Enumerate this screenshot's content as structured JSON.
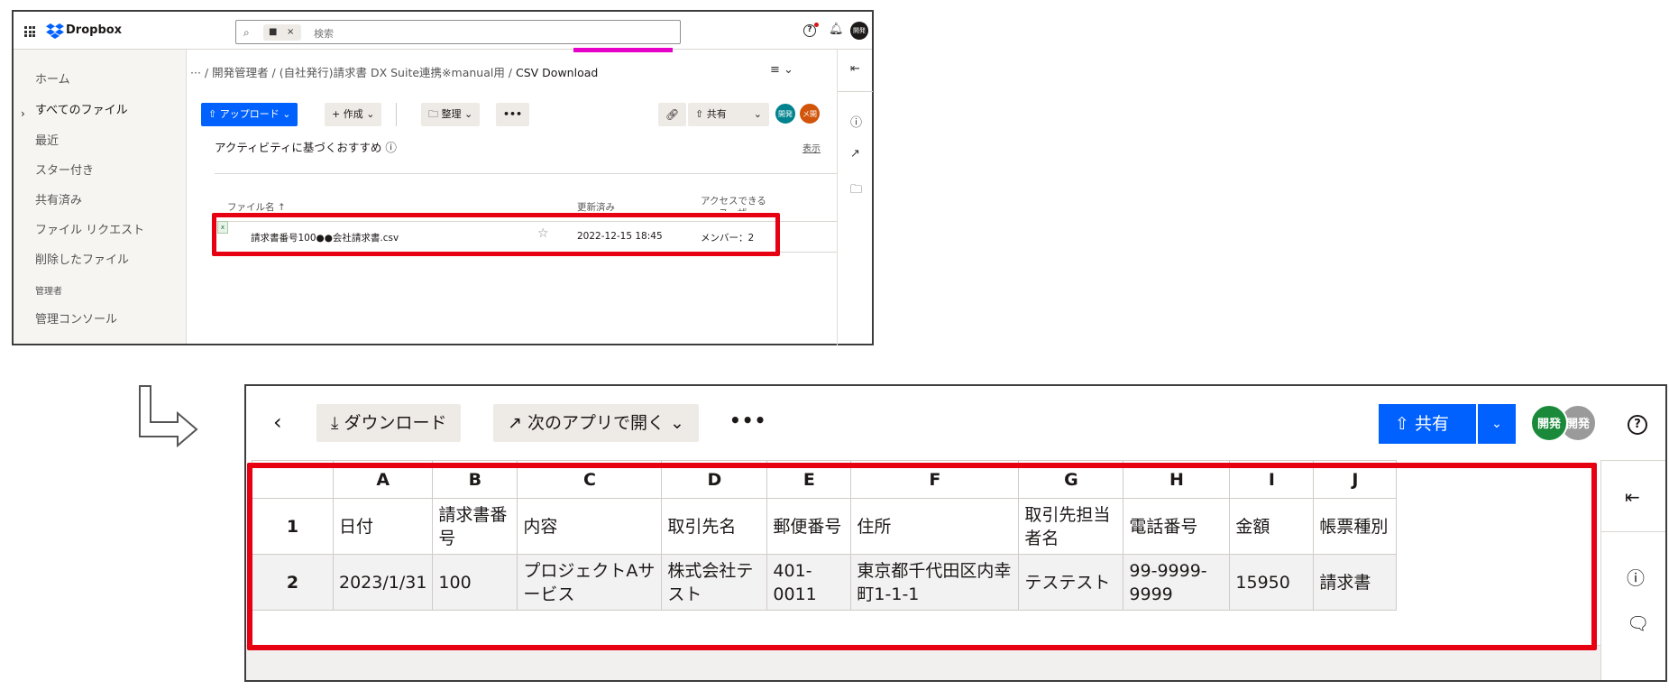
{
  "top": {
    "brand": "Dropbox",
    "search": {
      "chip_close": "×",
      "placeholder": "検索"
    },
    "header_avatar": "開発",
    "sidebar": {
      "items": [
        "ホーム",
        "すべてのファイル",
        "最近",
        "スター付き",
        "共有済み",
        "ファイル リクエスト",
        "削除したファイル",
        "管理者",
        "管理コンソール"
      ],
      "active_index": 1
    },
    "breadcrumb": {
      "prefix": "··· / 開発管理者 /  (自社発行)請求書  DX Suite連携※manual用 / ",
      "current": "CSV Download"
    },
    "toolbar": {
      "upload": "⇧ アップロード ⌄",
      "create": "+ 作成 ⌄",
      "organize": "整理 ⌄",
      "more": "•••",
      "share": "共有",
      "share_caret": "⌄"
    },
    "avatars": [
      "開発",
      "メ開"
    ],
    "suggest_title": "アクティビティに基づくおすすめ ⓘ",
    "show_link": "表示",
    "columns": {
      "name": "ファイル名 ↑",
      "modified": "更新済み",
      "access_line1": "アクセスできる",
      "access_line2": "ユーザー"
    },
    "file": {
      "name": "請求書番号100●●会社請求書.csv",
      "modified": "2022-12-15 18:45",
      "access": "メンバー：2"
    }
  },
  "bottom": {
    "download": "⤓ ダウンロード",
    "open_with": "次のアプリで開く ⌄",
    "more": "•••",
    "share": "共有",
    "avatars": [
      "開発",
      "開発"
    ],
    "sheet": {
      "col_headers": [
        "A",
        "B",
        "C",
        "D",
        "E",
        "F",
        "G",
        "H",
        "I",
        "J"
      ],
      "rows": [
        {
          "num": "1",
          "cells": [
            "日付",
            "請求書番号",
            "内容",
            "取引先名",
            "郵便番号",
            "住所",
            "取引先担当者名",
            "電話番号",
            "金額",
            "帳票種別"
          ]
        },
        {
          "num": "2",
          "cells": [
            "2023/1/31",
            "100",
            "プロジェクトAサービス",
            "株式会社テスト",
            "401-0011",
            "東京都千代田区内幸町1-1-1",
            "テステスト",
            "99-9999-9999",
            "15950",
            "請求書"
          ]
        }
      ]
    }
  },
  "colors": {
    "accent": "#0061fe",
    "highlight_red": "#e60012",
    "magenta": "#e600c8",
    "avatar_teal": "#00838f",
    "avatar_orange": "#d1540a",
    "avatar_green": "#1a8a3a",
    "avatar_grey": "#9a9a9a"
  }
}
